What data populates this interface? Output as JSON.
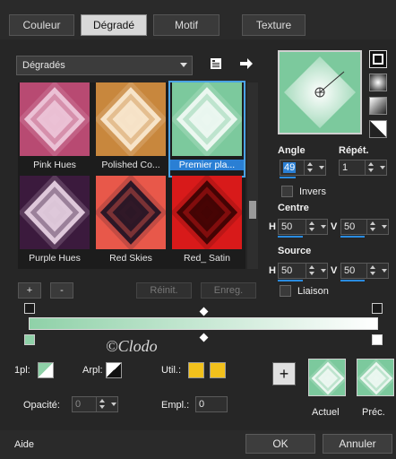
{
  "tabs": [
    {
      "label": "Couleur"
    },
    {
      "label": "Dégradé"
    },
    {
      "label": "Motif"
    },
    {
      "label": "Texture"
    }
  ],
  "gallery": {
    "category": "Dégradés",
    "items": [
      {
        "label": "Pink Hues",
        "colors": [
          "#f4d6e6",
          "#b84a72"
        ]
      },
      {
        "label": "Polished Co...",
        "colors": [
          "#fff4e2",
          "#c8873d"
        ]
      },
      {
        "label": "Premier pla...",
        "colors": [
          "#ffffff",
          "#7cc99d"
        ]
      },
      {
        "label": "Purple Hues",
        "colors": [
          "#fbe7f6",
          "#3b1a3d"
        ]
      },
      {
        "label": "Red Skies",
        "colors": [
          "#0b0b20",
          "#e8584a"
        ]
      },
      {
        "label": "Red_ Satin",
        "colors": [
          "#2a0000",
          "#d81a1a"
        ]
      }
    ],
    "selected_index": 2,
    "reset_label": "Réinit.",
    "save_label": "Enreg."
  },
  "settings": {
    "angle_label": "Angle",
    "angle_value": "49",
    "repeat_label": "Répét.",
    "repeat_value": "1",
    "invert_label": "Invers",
    "center_label": "Centre",
    "center_h_label": "H",
    "center_h": "50",
    "center_v_label": "V",
    "center_v": "50",
    "source_label": "Source",
    "source_h_label": "H",
    "source_h": "50",
    "source_v_label": "V",
    "source_v": "50",
    "link_label": "Liaison"
  },
  "bottom": {
    "plan_label": "1pl:",
    "arrplan_label": "Arpl:",
    "util_label": "Util.:",
    "opacity_label": "Opacité:",
    "opacity_value": "0",
    "empl_label": "Empl.:",
    "empl_value": "0",
    "current_label": "Actuel",
    "previous_label": "Préc.",
    "add_label": "+"
  },
  "footer": {
    "help_label": "Aide",
    "ok_label": "OK",
    "cancel_label": "Annuler"
  },
  "watermark": "©Clodo",
  "colors": {
    "accent": "#2a8be0",
    "gradient_start": "#8fd1a8",
    "gradient_end": "#ffffff",
    "user_color": "#f2c11c"
  }
}
